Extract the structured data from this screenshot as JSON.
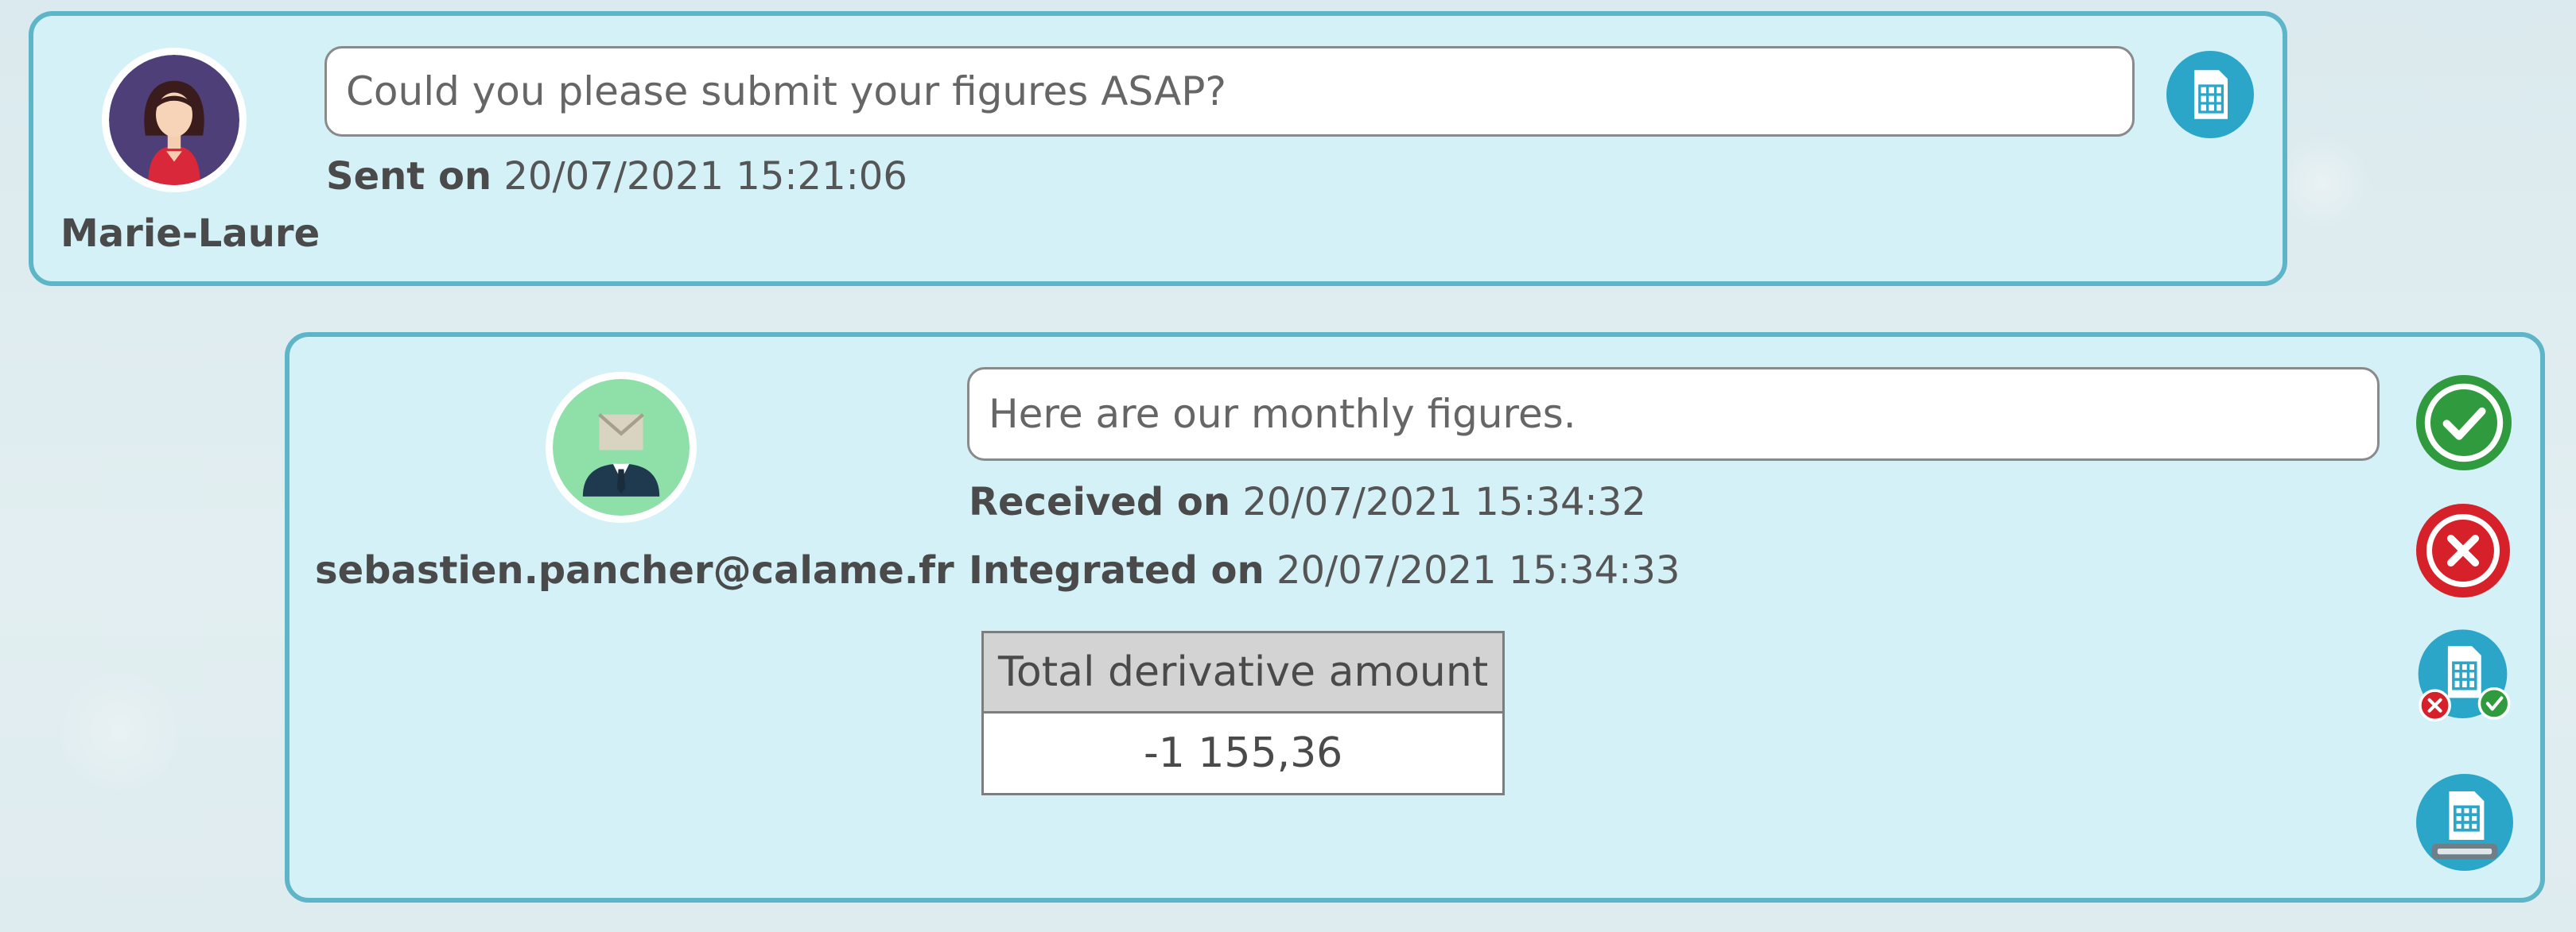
{
  "messages": [
    {
      "sender": "Marie-Laure",
      "text": "Could you please submit your figures ASAP?",
      "sent_label": "Sent on",
      "sent_value": "20/07/2021 15:21:06",
      "icon": "spreadsheet-icon"
    },
    {
      "sender": "sebastien.pancher@calame.fr",
      "text": "Here are our monthly figures.",
      "received_label": "Received on",
      "received_value": "20/07/2021 15:34:32",
      "integrated_label": "Integrated on",
      "integrated_value": "20/07/2021 15:34:33",
      "table": {
        "header": "Total derivative amount",
        "value": "-1 155,36"
      },
      "actions": [
        {
          "icon": "approve-check-icon"
        },
        {
          "icon": "reject-x-icon"
        },
        {
          "icon": "spreadsheet-validation-icon"
        },
        {
          "icon": "spreadsheet-numbers-icon"
        }
      ]
    }
  ],
  "colors": {
    "card_bg": "#d4f1f8",
    "card_border": "#5db5c7",
    "accent_blue": "#2ba6c9",
    "approve_green": "#2f9a3e",
    "reject_red": "#d6202a"
  }
}
